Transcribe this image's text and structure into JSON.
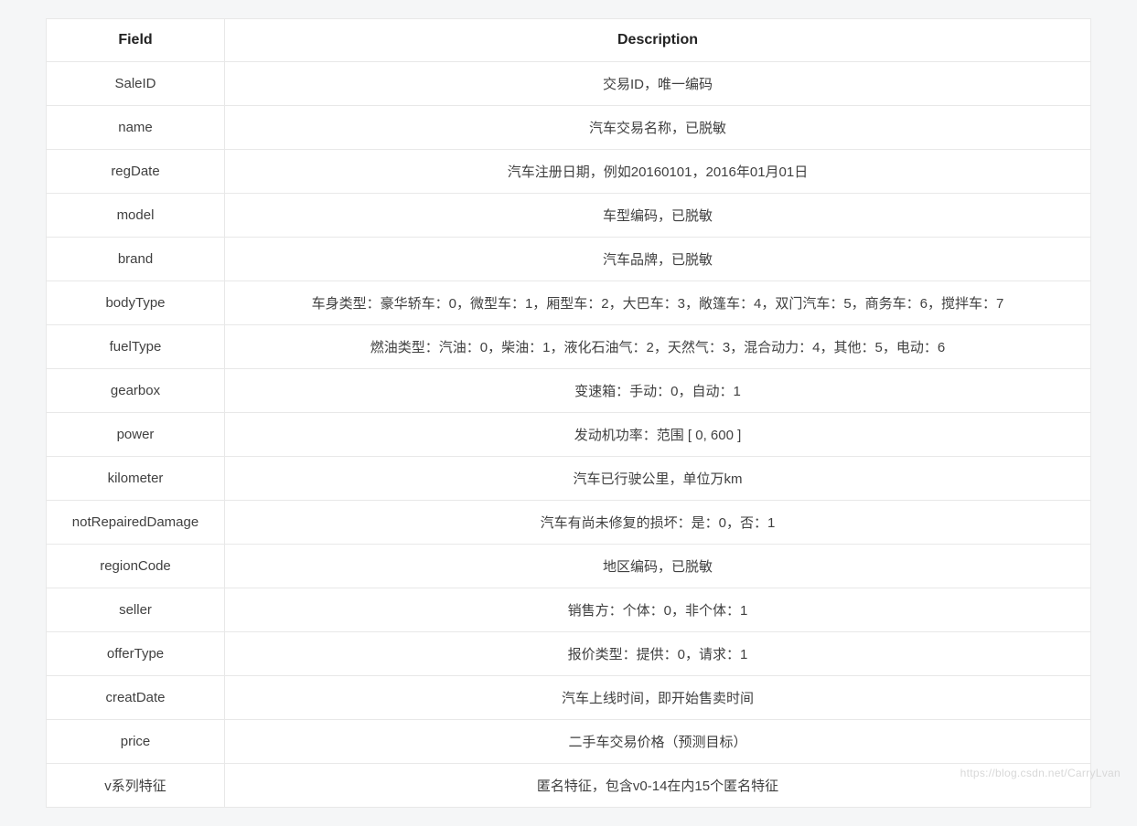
{
  "table": {
    "headers": {
      "field": "Field",
      "description": "Description"
    },
    "rows": [
      {
        "field": "SaleID",
        "description": "交易ID，唯一编码"
      },
      {
        "field": "name",
        "description": "汽车交易名称，已脱敏"
      },
      {
        "field": "regDate",
        "description": "汽车注册日期，例如20160101，2016年01月01日"
      },
      {
        "field": "model",
        "description": "车型编码，已脱敏"
      },
      {
        "field": "brand",
        "description": "汽车品牌，已脱敏"
      },
      {
        "field": "bodyType",
        "description": "车身类型：豪华轿车：0，微型车：1，厢型车：2，大巴车：3，敞篷车：4，双门汽车：5，商务车：6，搅拌车：7"
      },
      {
        "field": "fuelType",
        "description": "燃油类型：汽油：0，柴油：1，液化石油气：2，天然气：3，混合动力：4，其他：5，电动：6"
      },
      {
        "field": "gearbox",
        "description": "变速箱：手动：0，自动：1"
      },
      {
        "field": "power",
        "description": "发动机功率：范围 [ 0, 600 ]"
      },
      {
        "field": "kilometer",
        "description": "汽车已行驶公里，单位万km"
      },
      {
        "field": "notRepairedDamage",
        "description": "汽车有尚未修复的损坏：是：0，否：1"
      },
      {
        "field": "regionCode",
        "description": "地区编码，已脱敏"
      },
      {
        "field": "seller",
        "description": "销售方：个体：0，非个体：1"
      },
      {
        "field": "offerType",
        "description": "报价类型：提供：0，请求：1"
      },
      {
        "field": "creatDate",
        "description": "汽车上线时间，即开始售卖时间"
      },
      {
        "field": "price",
        "description": "二手车交易价格（预测目标）"
      },
      {
        "field": "v系列特征",
        "description": "匿名特征，包含v0-14在内15个匿名特征"
      }
    ]
  },
  "watermark": "https://blog.csdn.net/CarryLvan"
}
